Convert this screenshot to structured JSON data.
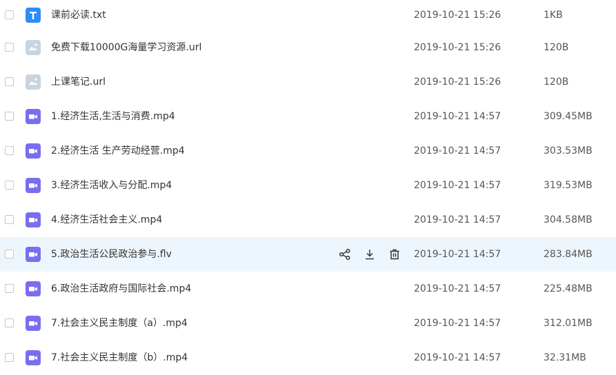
{
  "colors": {
    "txt_icon": "#2f8bf6",
    "link_icon": "#c9d4de",
    "video_icon": "#7a6df0",
    "hover_row": "#eef6fd",
    "action_icon": "#333333"
  },
  "files": [
    {
      "name": "课前必读.txt",
      "date": "2019-10-21 15:26",
      "size": "1KB",
      "icon": "txt-file-icon",
      "icon_letter": "T"
    },
    {
      "name": "免费下载10000G海量学习资源.url",
      "date": "2019-10-21 15:26",
      "size": "120B",
      "icon": "link-file-icon"
    },
    {
      "name": "上课笔记.url",
      "date": "2019-10-21 15:26",
      "size": "120B",
      "icon": "link-file-icon"
    },
    {
      "name": "1.经济生活,生活与消费.mp4",
      "date": "2019-10-21 14:57",
      "size": "309.45MB",
      "icon": "video-file-icon"
    },
    {
      "name": "2.经济生活 生产劳动经营.mp4",
      "date": "2019-10-21 14:57",
      "size": "303.53MB",
      "icon": "video-file-icon"
    },
    {
      "name": "3.经济生活收入与分配.mp4",
      "date": "2019-10-21 14:57",
      "size": "319.53MB",
      "icon": "video-file-icon"
    },
    {
      "name": "4.经济生活社会主义.mp4",
      "date": "2019-10-21 14:57",
      "size": "304.58MB",
      "icon": "video-file-icon"
    },
    {
      "name": "5.政治生活公民政治参与.flv",
      "date": "2019-10-21 14:57",
      "size": "283.84MB",
      "icon": "video-file-icon",
      "hovered": true
    },
    {
      "name": "6.政治生活政府与国际社会.mp4",
      "date": "2019-10-21 14:57",
      "size": "225.48MB",
      "icon": "video-file-icon"
    },
    {
      "name": "7.社会主义民主制度（a）.mp4",
      "date": "2019-10-21 14:57",
      "size": "312.01MB",
      "icon": "video-file-icon"
    },
    {
      "name": "7.社会主义民主制度（b）.mp4",
      "date": "2019-10-21 14:57",
      "size": "32.31MB",
      "icon": "video-file-icon"
    }
  ],
  "row_actions": [
    {
      "icon": "share-icon"
    },
    {
      "icon": "download-icon"
    },
    {
      "icon": "delete-icon"
    }
  ]
}
